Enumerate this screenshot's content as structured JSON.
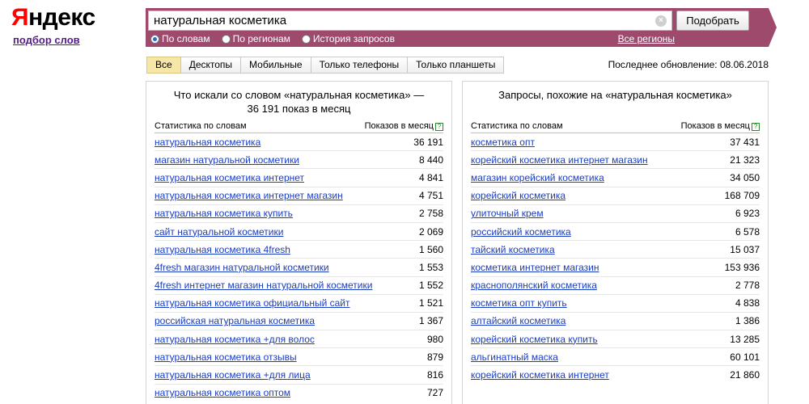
{
  "logo": {
    "first_letter": "Я",
    "rest": "ндекс",
    "subtitle": "подбор слов"
  },
  "search": {
    "value": "натуральная косметика",
    "button_label": "Подобрать",
    "clear_icon": "×",
    "modes": [
      {
        "label": "По словам",
        "selected": true
      },
      {
        "label": "По регионам",
        "selected": false
      },
      {
        "label": "История запросов",
        "selected": false
      }
    ],
    "regions_link": "Все регионы"
  },
  "tabs": [
    "Все",
    "Десктопы",
    "Мобильные",
    "Только телефоны",
    "Только планшеты"
  ],
  "last_updated": "Последнее обновление: 08.06.2018",
  "left_panel": {
    "title": "Что искали со словом «натуральная косметика» — 36 191 показ в месяц",
    "col_words": "Статистика по словам",
    "col_shows": "Показов в месяц",
    "help_icon": "?",
    "rows": [
      {
        "q": "натуральная косметика",
        "n": "36 191"
      },
      {
        "q": "магазин натуральной косметики",
        "n": "8 440"
      },
      {
        "q": "натуральная косметика интернет",
        "n": "4 841"
      },
      {
        "q": "натуральная косметика интернет магазин",
        "n": "4 751"
      },
      {
        "q": "натуральная косметика купить",
        "n": "2 758"
      },
      {
        "q": "сайт натуральной косметики",
        "n": "2 069"
      },
      {
        "q": "натуральная косметика 4fresh",
        "n": "1 560"
      },
      {
        "q": "4fresh магазин натуральной косметики",
        "n": "1 553"
      },
      {
        "q": "4fresh интернет магазин натуральной косметики",
        "n": "1 552"
      },
      {
        "q": "натуральная косметика официальный сайт",
        "n": "1 521"
      },
      {
        "q": "российская натуральная косметика",
        "n": "1 367"
      },
      {
        "q": "натуральная косметика +для волос",
        "n": "980"
      },
      {
        "q": "натуральная косметика отзывы",
        "n": "879"
      },
      {
        "q": "натуральная косметика +для лица",
        "n": "816"
      },
      {
        "q": "натуральная косметика оптом",
        "n": "727"
      }
    ]
  },
  "right_panel": {
    "title": "Запросы, похожие на «натуральная косметика»",
    "col_words": "Статистика по словам",
    "col_shows": "Показов в месяц",
    "help_icon": "?",
    "rows": [
      {
        "q": "косметика опт",
        "n": "37 431"
      },
      {
        "q": "корейский косметика интернет магазин",
        "n": "21 323"
      },
      {
        "q": "магазин корейский косметика",
        "n": "34 050"
      },
      {
        "q": "корейский косметика",
        "n": "168 709"
      },
      {
        "q": "улиточный крем",
        "n": "6 923"
      },
      {
        "q": "российский косметика",
        "n": "6 578"
      },
      {
        "q": "тайский косметика",
        "n": "15 037"
      },
      {
        "q": "косметика интернет магазин",
        "n": "153 936"
      },
      {
        "q": "краснополянский косметика",
        "n": "2 778"
      },
      {
        "q": "косметика опт купить",
        "n": "4 838"
      },
      {
        "q": "алтайский косметика",
        "n": "1 386"
      },
      {
        "q": "корейский косметика купить",
        "n": "13 285"
      },
      {
        "q": "альгинатный маска",
        "n": "60 101"
      },
      {
        "q": "корейский косметика интернет",
        "n": "21 860"
      }
    ]
  }
}
